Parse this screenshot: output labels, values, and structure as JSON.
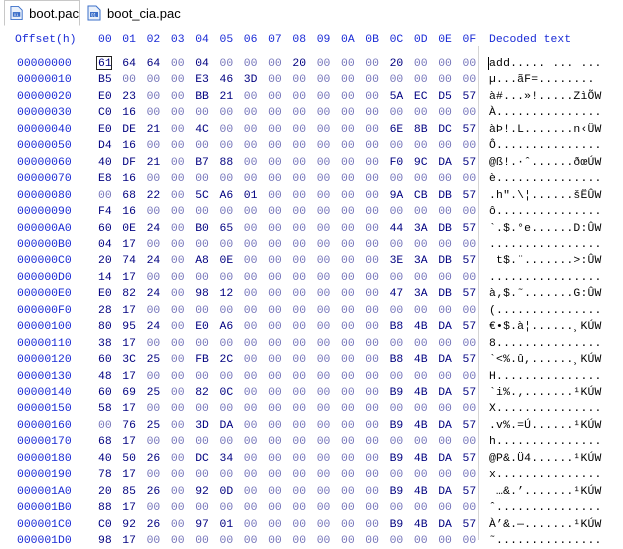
{
  "tabs": [
    {
      "label": "boot.pac",
      "active": true
    },
    {
      "label": "boot_cia.pac",
      "active": false
    }
  ],
  "header": {
    "offset_label": "Offset(h)",
    "columns": [
      "00",
      "01",
      "02",
      "03",
      "04",
      "05",
      "06",
      "07",
      "08",
      "09",
      "0A",
      "0B",
      "0C",
      "0D",
      "0E",
      "0F"
    ],
    "decoded_label": "Decoded text"
  },
  "rows": [
    {
      "offset": "00000000",
      "bytes": [
        "61",
        "64",
        "64",
        "00",
        "04",
        "00",
        "00",
        "00",
        "20",
        "00",
        "00",
        "00",
        "20",
        "00",
        "00",
        "00"
      ],
      "text": "add..... ... ..."
    },
    {
      "offset": "00000010",
      "bytes": [
        "B5",
        "00",
        "00",
        "00",
        "E3",
        "46",
        "3D",
        "00",
        "00",
        "00",
        "00",
        "00",
        "00",
        "00",
        "00",
        "00"
      ],
      "text": "µ...ãF=........"
    },
    {
      "offset": "00000020",
      "bytes": [
        "E0",
        "23",
        "00",
        "00",
        "BB",
        "21",
        "00",
        "00",
        "00",
        "00",
        "00",
        "00",
        "5A",
        "EC",
        "D5",
        "57"
      ],
      "text": "à#...»!.....ZìÕW"
    },
    {
      "offset": "00000030",
      "bytes": [
        "C0",
        "16",
        "00",
        "00",
        "00",
        "00",
        "00",
        "00",
        "00",
        "00",
        "00",
        "00",
        "00",
        "00",
        "00",
        "00"
      ],
      "text": "À..............."
    },
    {
      "offset": "00000040",
      "bytes": [
        "E0",
        "DE",
        "21",
        "00",
        "4C",
        "00",
        "00",
        "00",
        "00",
        "00",
        "00",
        "00",
        "6E",
        "8B",
        "DC",
        "57"
      ],
      "text": "àÞ!.L.......n‹ÜW"
    },
    {
      "offset": "00000050",
      "bytes": [
        "D4",
        "16",
        "00",
        "00",
        "00",
        "00",
        "00",
        "00",
        "00",
        "00",
        "00",
        "00",
        "00",
        "00",
        "00",
        "00"
      ],
      "text": "Ô..............."
    },
    {
      "offset": "00000060",
      "bytes": [
        "40",
        "DF",
        "21",
        "00",
        "B7",
        "88",
        "00",
        "00",
        "00",
        "00",
        "00",
        "00",
        "F0",
        "9C",
        "DA",
        "57"
      ],
      "text": "@ß!.·ˆ......ðœÚW"
    },
    {
      "offset": "00000070",
      "bytes": [
        "E8",
        "16",
        "00",
        "00",
        "00",
        "00",
        "00",
        "00",
        "00",
        "00",
        "00",
        "00",
        "00",
        "00",
        "00",
        "00"
      ],
      "text": "è..............."
    },
    {
      "offset": "00000080",
      "bytes": [
        "00",
        "68",
        "22",
        "00",
        "5C",
        "A6",
        "01",
        "00",
        "00",
        "00",
        "00",
        "00",
        "9A",
        "CB",
        "DB",
        "57"
      ],
      "text": ".h\".\\¦......šËÛW"
    },
    {
      "offset": "00000090",
      "bytes": [
        "F4",
        "16",
        "00",
        "00",
        "00",
        "00",
        "00",
        "00",
        "00",
        "00",
        "00",
        "00",
        "00",
        "00",
        "00",
        "00"
      ],
      "text": "ô..............."
    },
    {
      "offset": "000000A0",
      "bytes": [
        "60",
        "0E",
        "24",
        "00",
        "B0",
        "65",
        "00",
        "00",
        "00",
        "00",
        "00",
        "00",
        "44",
        "3A",
        "DB",
        "57"
      ],
      "text": "`.$.°e......D:ÛW"
    },
    {
      "offset": "000000B0",
      "bytes": [
        "04",
        "17",
        "00",
        "00",
        "00",
        "00",
        "00",
        "00",
        "00",
        "00",
        "00",
        "00",
        "00",
        "00",
        "00",
        "00"
      ],
      "text": "................"
    },
    {
      "offset": "000000C0",
      "bytes": [
        "20",
        "74",
        "24",
        "00",
        "A8",
        "0E",
        "00",
        "00",
        "00",
        "00",
        "00",
        "00",
        "3E",
        "3A",
        "DB",
        "57"
      ],
      "text": " t$.¨.......>:ÛW"
    },
    {
      "offset": "000000D0",
      "bytes": [
        "14",
        "17",
        "00",
        "00",
        "00",
        "00",
        "00",
        "00",
        "00",
        "00",
        "00",
        "00",
        "00",
        "00",
        "00",
        "00"
      ],
      "text": "................"
    },
    {
      "offset": "000000E0",
      "bytes": [
        "E0",
        "82",
        "24",
        "00",
        "98",
        "12",
        "00",
        "00",
        "00",
        "00",
        "00",
        "00",
        "47",
        "3A",
        "DB",
        "57"
      ],
      "text": "à‚$.˜.......G:ÛW"
    },
    {
      "offset": "000000F0",
      "bytes": [
        "28",
        "17",
        "00",
        "00",
        "00",
        "00",
        "00",
        "00",
        "00",
        "00",
        "00",
        "00",
        "00",
        "00",
        "00",
        "00"
      ],
      "text": "(..............."
    },
    {
      "offset": "00000100",
      "bytes": [
        "80",
        "95",
        "24",
        "00",
        "E0",
        "A6",
        "00",
        "00",
        "00",
        "00",
        "00",
        "00",
        "B8",
        "4B",
        "DA",
        "57"
      ],
      "text": "€•$.à¦......¸KÚW"
    },
    {
      "offset": "00000110",
      "bytes": [
        "38",
        "17",
        "00",
        "00",
        "00",
        "00",
        "00",
        "00",
        "00",
        "00",
        "00",
        "00",
        "00",
        "00",
        "00",
        "00"
      ],
      "text": "8..............."
    },
    {
      "offset": "00000120",
      "bytes": [
        "60",
        "3C",
        "25",
        "00",
        "FB",
        "2C",
        "00",
        "00",
        "00",
        "00",
        "00",
        "00",
        "B8",
        "4B",
        "DA",
        "57"
      ],
      "text": "`<%.û,......¸KÚW"
    },
    {
      "offset": "00000130",
      "bytes": [
        "48",
        "17",
        "00",
        "00",
        "00",
        "00",
        "00",
        "00",
        "00",
        "00",
        "00",
        "00",
        "00",
        "00",
        "00",
        "00"
      ],
      "text": "H..............."
    },
    {
      "offset": "00000140",
      "bytes": [
        "60",
        "69",
        "25",
        "00",
        "82",
        "0C",
        "00",
        "00",
        "00",
        "00",
        "00",
        "00",
        "B9",
        "4B",
        "DA",
        "57"
      ],
      "text": "`i%.‚.......¹KÚW"
    },
    {
      "offset": "00000150",
      "bytes": [
        "58",
        "17",
        "00",
        "00",
        "00",
        "00",
        "00",
        "00",
        "00",
        "00",
        "00",
        "00",
        "00",
        "00",
        "00",
        "00"
      ],
      "text": "X..............."
    },
    {
      "offset": "00000160",
      "bytes": [
        "00",
        "76",
        "25",
        "00",
        "3D",
        "DA",
        "00",
        "00",
        "00",
        "00",
        "00",
        "00",
        "B9",
        "4B",
        "DA",
        "57"
      ],
      "text": ".v%.=Ú......¹KÚW"
    },
    {
      "offset": "00000170",
      "bytes": [
        "68",
        "17",
        "00",
        "00",
        "00",
        "00",
        "00",
        "00",
        "00",
        "00",
        "00",
        "00",
        "00",
        "00",
        "00",
        "00"
      ],
      "text": "h..............."
    },
    {
      "offset": "00000180",
      "bytes": [
        "40",
        "50",
        "26",
        "00",
        "DC",
        "34",
        "00",
        "00",
        "00",
        "00",
        "00",
        "00",
        "B9",
        "4B",
        "DA",
        "57"
      ],
      "text": "@P&.Ü4......¹KÚW"
    },
    {
      "offset": "00000190",
      "bytes": [
        "78",
        "17",
        "00",
        "00",
        "00",
        "00",
        "00",
        "00",
        "00",
        "00",
        "00",
        "00",
        "00",
        "00",
        "00",
        "00"
      ],
      "text": "x..............."
    },
    {
      "offset": "000001A0",
      "bytes": [
        "20",
        "85",
        "26",
        "00",
        "92",
        "0D",
        "00",
        "00",
        "00",
        "00",
        "00",
        "00",
        "B9",
        "4B",
        "DA",
        "57"
      ],
      "text": " …&.’.......¹KÚW"
    },
    {
      "offset": "000001B0",
      "bytes": [
        "88",
        "17",
        "00",
        "00",
        "00",
        "00",
        "00",
        "00",
        "00",
        "00",
        "00",
        "00",
        "00",
        "00",
        "00",
        "00"
      ],
      "text": "ˆ..............."
    },
    {
      "offset": "000001C0",
      "bytes": [
        "C0",
        "92",
        "26",
        "00",
        "97",
        "01",
        "00",
        "00",
        "00",
        "00",
        "00",
        "00",
        "B9",
        "4B",
        "DA",
        "57"
      ],
      "text": "À’&.—.......¹KÚW"
    },
    {
      "offset": "000001D0",
      "bytes": [
        "98",
        "17",
        "00",
        "00",
        "00",
        "00",
        "00",
        "00",
        "00",
        "00",
        "00",
        "00",
        "00",
        "00",
        "00",
        "00"
      ],
      "text": "˜..............."
    }
  ],
  "icons": {
    "file_icon": "file-pac-icon"
  },
  "colors": {
    "hex_blue": "#1a2bd6",
    "byte_navy": "#000080"
  }
}
